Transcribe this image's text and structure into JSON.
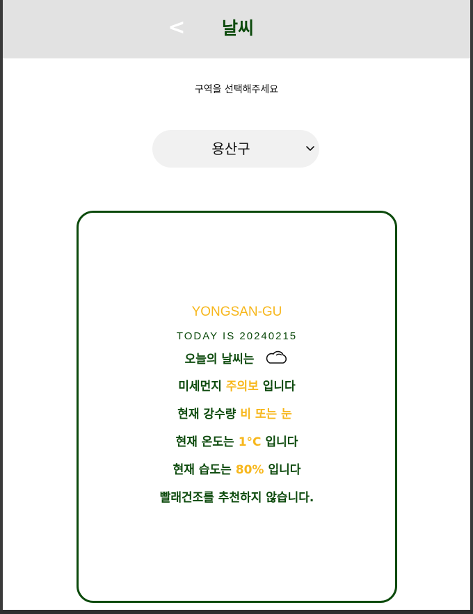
{
  "header": {
    "back_label": "<",
    "title": "날씨"
  },
  "selector": {
    "prompt": "구역을 선택해주세요",
    "selected_value": "용산구",
    "chevron_icon": "chevron-down-icon"
  },
  "weather_card": {
    "district_name": "YONGSAN-GU",
    "today_line": "TODAY IS 20240215",
    "weather_label": "오늘의 날씨는",
    "weather_icon": "cloud-icon",
    "dust_label": "미세먼지",
    "dust_value": "주의보",
    "dust_suffix": "입니다",
    "precip_label": "현재 강수량",
    "precip_value": "비 또는 눈",
    "temp_label": "현재 온도는",
    "temp_value": "1°C",
    "temp_suffix": "입니다",
    "humidity_label": "현재 습도는",
    "humidity_value": "80%",
    "humidity_suffix": "입니다",
    "recommendation": "빨래건조를 추천하지 않습니다."
  },
  "colors": {
    "header_bg": "#e2e2e2",
    "brand_green": "#0c4a0c",
    "highlight_yellow": "#f7b71c",
    "select_bg": "#f1f1f1"
  }
}
